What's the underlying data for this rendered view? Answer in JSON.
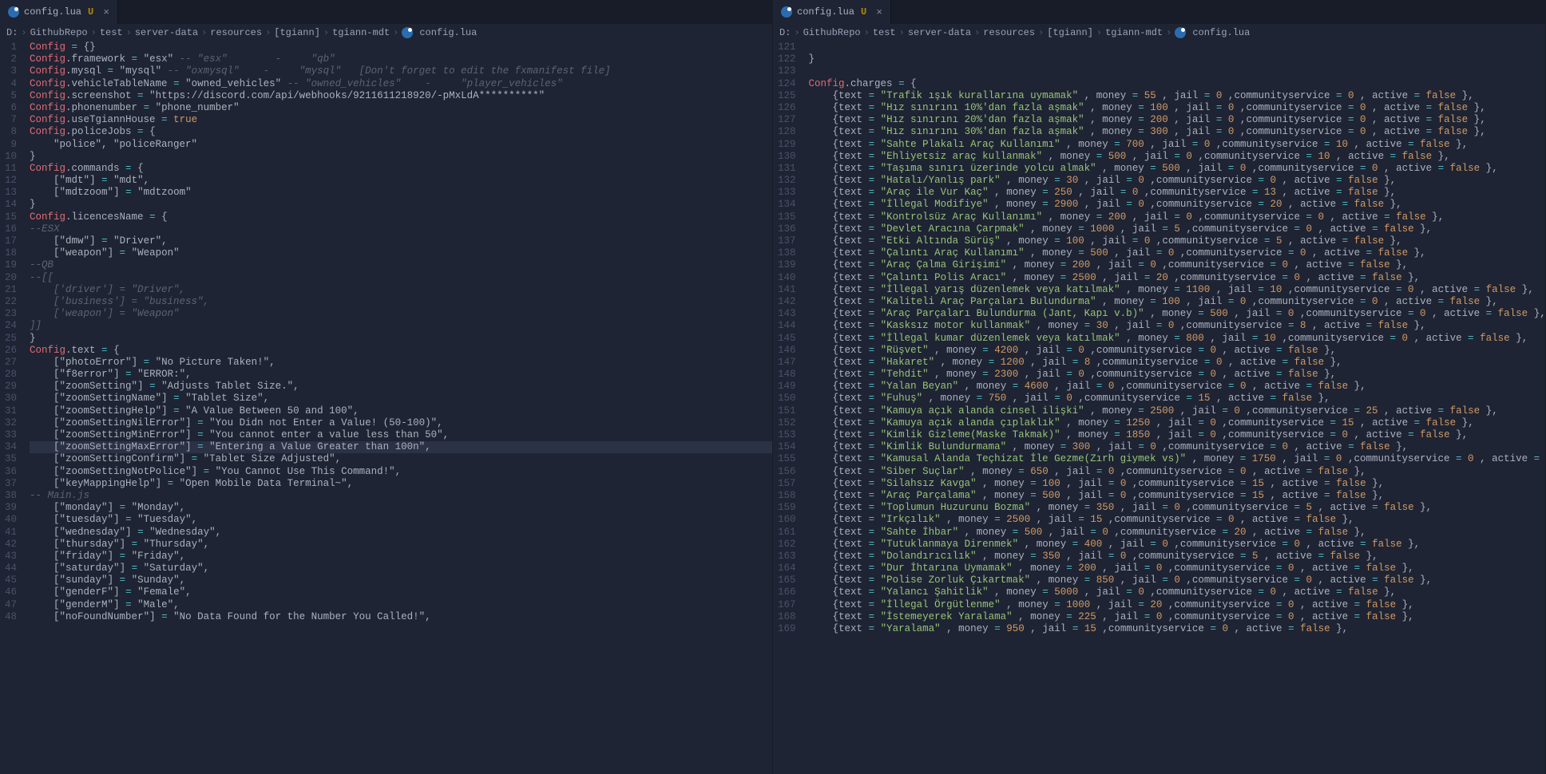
{
  "leftTab": {
    "file": "config.lua",
    "modified": "U"
  },
  "rightTab": {
    "file": "config.lua",
    "modified": "U"
  },
  "breadcrumbLeft": [
    "D:",
    "GithubRepo",
    "test",
    "server-data",
    "resources",
    "[tgiann]",
    "tgiann-mdt",
    "config.lua"
  ],
  "breadcrumbRight": [
    "D:",
    "GithubRepo",
    "test",
    "server-data",
    "resources",
    "[tgiann]",
    "tgiann-mdt",
    "config.lua"
  ],
  "left": {
    "startLine": 1,
    "lines": [
      {
        "n": 1,
        "raw": "Config = {}"
      },
      {
        "n": 2,
        "raw": "Config.framework = \"esx\" -- \"esx\"        -     \"qb\""
      },
      {
        "n": 3,
        "raw": "Config.mysql = \"mysql\" -- \"oxmysql\"    -     \"mysql\"   [Don't forget to edit the fxmanifest file]"
      },
      {
        "n": 4,
        "raw": "Config.vehicleTableName = \"owned_vehicles\" -- \"owned_vehicles\"    -     \"player_vehicles\""
      },
      {
        "n": 5,
        "raw": "Config.screenshot = \"https://discord.com/api/webhooks/9211611218920/-pMxLdA**********\""
      },
      {
        "n": 6,
        "raw": "Config.phonenumber = \"phone_number\""
      },
      {
        "n": 7,
        "raw": "Config.useTgiannHouse = true"
      },
      {
        "n": 8,
        "raw": "Config.policeJobs = {"
      },
      {
        "n": 9,
        "raw": "    \"police\", \"policeRanger\""
      },
      {
        "n": 10,
        "raw": "}"
      },
      {
        "n": 11,
        "raw": "Config.commands = {"
      },
      {
        "n": 12,
        "raw": "    [\"mdt\"] = \"mdt\","
      },
      {
        "n": 13,
        "raw": "    [\"mdtzoom\"] = \"mdtzoom\""
      },
      {
        "n": 14,
        "raw": "}"
      },
      {
        "n": 15,
        "raw": "Config.licencesName = {"
      },
      {
        "n": 16,
        "raw": "    --ESX"
      },
      {
        "n": 17,
        "raw": "    [\"dmw\"] = \"Driver\","
      },
      {
        "n": 18,
        "raw": "    [\"weapon\"] = \"Weapon\""
      },
      {
        "n": 19,
        "raw": "    --QB"
      },
      {
        "n": 20,
        "raw": "--[["
      },
      {
        "n": 21,
        "raw": "    ['driver'] = \"Driver\","
      },
      {
        "n": 22,
        "raw": "    ['business'] = \"business\","
      },
      {
        "n": 23,
        "raw": "    ['weapon'] = \"Weapon\""
      },
      {
        "n": 24,
        "raw": "]]"
      },
      {
        "n": 25,
        "raw": "}"
      },
      {
        "n": 26,
        "raw": "Config.text = {"
      },
      {
        "n": 27,
        "raw": "    [\"photoError\"] = \"No Picture Taken!\","
      },
      {
        "n": 28,
        "raw": "    [\"f8error\"] = \"ERROR:\","
      },
      {
        "n": 29,
        "raw": "    [\"zoomSetting\"] = \"Adjusts Tablet Size.\","
      },
      {
        "n": 30,
        "raw": "    [\"zoomSettingName\"] = \"Tablet Size\","
      },
      {
        "n": 31,
        "raw": "    [\"zoomSettingHelp\"] = \"A Value Between 50 and 100\","
      },
      {
        "n": 32,
        "raw": "    [\"zoomSettingNilError\"] = \"You Didn not Enter a Value! (50-100)\","
      },
      {
        "n": 33,
        "raw": "    [\"zoomSettingMinError\"] = \"You cannot enter a value less than 50\","
      },
      {
        "n": 34,
        "raw": "    [\"zoomSettingMaxError\"] = \"Entering a Value Greater than 100n\",",
        "hl": true
      },
      {
        "n": 35,
        "raw": "    [\"zoomSettingConfirm\"] = \"Tablet Size Adjusted\","
      },
      {
        "n": 36,
        "raw": "    [\"zoomSettingNotPolice\"] = \"You Cannot Use This Command!\","
      },
      {
        "n": 37,
        "raw": "    [\"keyMappingHelp\"] = \"Open Mobile Data Terminal~\","
      },
      {
        "n": 38,
        "raw": "    -- Main.js"
      },
      {
        "n": 39,
        "raw": "    [\"monday\"] = \"Monday\","
      },
      {
        "n": 40,
        "raw": "    [\"tuesday\"] = \"Tuesday\","
      },
      {
        "n": 41,
        "raw": "    [\"wednesday\"] = \"Wednesday\","
      },
      {
        "n": 42,
        "raw": "    [\"thursday\"] = \"Thursday\","
      },
      {
        "n": 43,
        "raw": "    [\"friday\"] = \"Friday\","
      },
      {
        "n": 44,
        "raw": "    [\"saturday\"] = \"Saturday\","
      },
      {
        "n": 45,
        "raw": "    [\"sunday\"] = \"Sunday\","
      },
      {
        "n": 46,
        "raw": "    [\"genderF\"] = \"Female\","
      },
      {
        "n": 47,
        "raw": "    [\"genderM\"] = \"Male\","
      },
      {
        "n": 48,
        "raw": "    [\"noFoundNumber\"] = \"No Data Found for the Number You Called!\","
      }
    ]
  },
  "right": {
    "startLine": 121,
    "header": "Config.charges = {",
    "headerLine": 124,
    "closeBracket": true,
    "preLines": [
      {
        "n": 121,
        "raw": ""
      },
      {
        "n": 122,
        "raw": "}"
      },
      {
        "n": 123,
        "raw": ""
      }
    ],
    "charges": [
      {
        "n": 125,
        "text": "Trafik ışık kurallarına uymamak",
        "money": 55,
        "jail": 0,
        "communityservice": 0,
        "active": "false"
      },
      {
        "n": 126,
        "text": "Hız sınırını 10%'dan fazla aşmak",
        "money": 100,
        "jail": 0,
        "communityservice": 0,
        "active": "false"
      },
      {
        "n": 127,
        "text": "Hız sınırını 20%'dan fazla aşmak",
        "money": 200,
        "jail": 0,
        "communityservice": 0,
        "active": "false"
      },
      {
        "n": 128,
        "text": "Hız sınırını 30%'dan fazla aşmak",
        "money": 300,
        "jail": 0,
        "communityservice": 0,
        "active": "false"
      },
      {
        "n": 129,
        "text": "Sahte Plakalı Araç Kullanımı",
        "money": 700,
        "jail": 0,
        "communityservice": 10,
        "active": "false"
      },
      {
        "n": 130,
        "text": "Ehliyetsiz araç kullanmak",
        "money": 500,
        "jail": 0,
        "communityservice": 10,
        "active": "false"
      },
      {
        "n": 131,
        "text": "Taşıma sınırı üzerinde yolcu almak",
        "money": 500,
        "jail": 0,
        "communityservice": 0,
        "active": "false"
      },
      {
        "n": 132,
        "text": "Hatalı/Yanlış park",
        "money": 30,
        "jail": 0,
        "communityservice": 0,
        "active": "false"
      },
      {
        "n": 133,
        "text": "Araç ile Vur Kaç",
        "money": 250,
        "jail": 0,
        "communityservice": 13,
        "active": "false"
      },
      {
        "n": 134,
        "text": "İllegal Modifiye",
        "money": 2900,
        "jail": 0,
        "communityservice": 20,
        "active": "false"
      },
      {
        "n": 135,
        "text": "Kontrolsüz Araç Kullanımı",
        "money": 200,
        "jail": 0,
        "communityservice": 0,
        "active": "false"
      },
      {
        "n": 136,
        "text": "Devlet Aracına Çarpmak",
        "money": 1000,
        "jail": 5,
        "communityservice": 0,
        "active": "false"
      },
      {
        "n": 137,
        "text": "Etki Altında Sürüş",
        "money": 100,
        "jail": 0,
        "communityservice": 5,
        "active": "false"
      },
      {
        "n": 138,
        "text": "Çalıntı Araç Kullanımı",
        "money": 500,
        "jail": 0,
        "communityservice": 0,
        "active": "false"
      },
      {
        "n": 139,
        "text": "Araç Çalma Girişimi",
        "money": 200,
        "jail": 0,
        "communityservice": 0,
        "active": "false"
      },
      {
        "n": 140,
        "text": "Çalıntı Polis Aracı",
        "money": 2500,
        "jail": 20,
        "communityservice": 0,
        "active": "false"
      },
      {
        "n": 141,
        "text": "İllegal yarış düzenlemek veya katılmak",
        "money": 1100,
        "jail": 10,
        "communityservice": 0,
        "active": "false"
      },
      {
        "n": 142,
        "text": "Kaliteli Araç Parçaları Bulundurma",
        "money": 100,
        "jail": 0,
        "communityservice": 0,
        "active": "false"
      },
      {
        "n": 143,
        "text": "Araç Parçaları Bulundurma (Jant, Kapı v.b)",
        "money": 500,
        "jail": 0,
        "communityservice": 0,
        "active": "false"
      },
      {
        "n": 144,
        "text": "Kasksız motor kullanmak",
        "money": 30,
        "jail": 0,
        "communityservice": 8,
        "active": "false"
      },
      {
        "n": 145,
        "text": "İllegal kumar düzenlemek veya katılmak",
        "money": 800,
        "jail": 10,
        "communityservice": 0,
        "active": "false"
      },
      {
        "n": 146,
        "text": "Rüşvet",
        "money": 4200,
        "jail": 0,
        "communityservice": 0,
        "active": "false"
      },
      {
        "n": 147,
        "text": "Hakaret",
        "money": 1200,
        "jail": 8,
        "communityservice": 0,
        "active": "false"
      },
      {
        "n": 148,
        "text": "Tehdit",
        "money": 2300,
        "jail": 0,
        "communityservice": 0,
        "active": "false"
      },
      {
        "n": 149,
        "text": "Yalan Beyan",
        "money": 4600,
        "jail": 0,
        "communityservice": 0,
        "active": "false"
      },
      {
        "n": 150,
        "text": "Fuhuş",
        "money": 750,
        "jail": 0,
        "communityservice": 15,
        "active": "false"
      },
      {
        "n": 151,
        "text": "Kamuya açık alanda cinsel ilişki",
        "money": 2500,
        "jail": 0,
        "communityservice": 25,
        "active": "false"
      },
      {
        "n": 152,
        "text": "Kamuya açık alanda çıplaklık",
        "money": 1250,
        "jail": 0,
        "communityservice": 15,
        "active": "false"
      },
      {
        "n": 153,
        "text": "Kimlik Gizleme(Maske Takmak)",
        "money": 1850,
        "jail": 0,
        "communityservice": 0,
        "active": "false"
      },
      {
        "n": 154,
        "text": "Kimlik Bulundurmama",
        "money": 300,
        "jail": 0,
        "communityservice": 0,
        "active": "false"
      },
      {
        "n": 155,
        "text": "Kamusal Alanda Teçhizat İle Gezme(Zırh giymek vs)",
        "money": 1750,
        "jail": 0,
        "communityservice": 0,
        "active": "false"
      },
      {
        "n": 156,
        "text": "Siber Suçlar",
        "money": 650,
        "jail": 0,
        "communityservice": 0,
        "active": "false"
      },
      {
        "n": 157,
        "text": "Silahsız Kavga",
        "money": 100,
        "jail": 0,
        "communityservice": 15,
        "active": "false"
      },
      {
        "n": 158,
        "text": "Araç Parçalama",
        "money": 500,
        "jail": 0,
        "communityservice": 15,
        "active": "false"
      },
      {
        "n": 159,
        "text": "Toplumun Huzurunu Bozma",
        "money": 350,
        "jail": 0,
        "communityservice": 5,
        "active": "false"
      },
      {
        "n": 160,
        "text": "Irkçılık",
        "money": 2500,
        "jail": 15,
        "communityservice": 0,
        "active": "false"
      },
      {
        "n": 161,
        "text": "Sahte İhbar",
        "money": 500,
        "jail": 0,
        "communityservice": 20,
        "active": "false"
      },
      {
        "n": 162,
        "text": "Tutuklanmaya Direnmek",
        "money": 400,
        "jail": 0,
        "communityservice": 0,
        "active": "false"
      },
      {
        "n": 163,
        "text": "Dolandırıcılık",
        "money": 350,
        "jail": 0,
        "communityservice": 5,
        "active": "false"
      },
      {
        "n": 164,
        "text": "Dur İhtarına Uymamak",
        "money": 200,
        "jail": 0,
        "communityservice": 0,
        "active": "false"
      },
      {
        "n": 165,
        "text": "Polise Zorluk Çıkartmak",
        "money": 850,
        "jail": 0,
        "communityservice": 0,
        "active": "false"
      },
      {
        "n": 166,
        "text": "Yalancı Şahitlik",
        "money": 5000,
        "jail": 0,
        "communityservice": 0,
        "active": "false"
      },
      {
        "n": 167,
        "text": "İllegal Örgütlenme",
        "money": 1000,
        "jail": 20,
        "communityservice": 0,
        "active": "false"
      },
      {
        "n": 168,
        "text": "İstemeyerek Yaralama",
        "money": 225,
        "jail": 0,
        "communityservice": 0,
        "active": "false"
      },
      {
        "n": 169,
        "text": "Yaralama",
        "money": 950,
        "jail": 15,
        "communityservice": 0,
        "active": "false"
      }
    ]
  }
}
